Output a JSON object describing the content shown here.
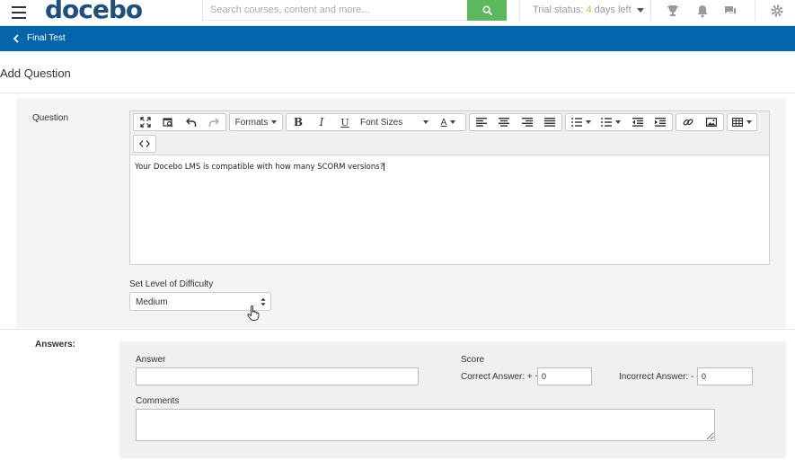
{
  "header": {
    "logo_text": "docebo",
    "logo_mark": "®",
    "search_placeholder": "Search courses, content and more...",
    "trial_prefix": "Trial status: ",
    "trial_days": "4",
    "trial_suffix": " days left",
    "icons": [
      "menu-icon",
      "search-icon",
      "trophy-icon",
      "bell-icon",
      "chat-icon",
      "gear-icon"
    ],
    "search_button_color": "#5cb85c"
  },
  "nav": {
    "back_label": "Final Test",
    "bar_color": "#0465ac"
  },
  "page": {
    "title": "Add Question"
  },
  "question": {
    "label": "Question",
    "toolbar": {
      "formats_label": "Formats",
      "font_sizes_label": "Font Sizes",
      "bold": "B",
      "italic": "I",
      "underline": "U",
      "text_color": "A"
    },
    "content": "Your Docebo LMS is compatible with how many SCORM versions?",
    "difficulty_label": "Set Level of Difficulty",
    "difficulty_value": "Medium"
  },
  "answers": {
    "section_label": "Answers:",
    "answer_label": "Answer",
    "answer_value": "",
    "score_label": "Score",
    "correct_label": "Correct Answer: + +",
    "correct_value": "0",
    "incorrect_label": "Incorrect Answer: - -",
    "incorrect_value": "0",
    "comments_label": "Comments",
    "comments_value": ""
  }
}
